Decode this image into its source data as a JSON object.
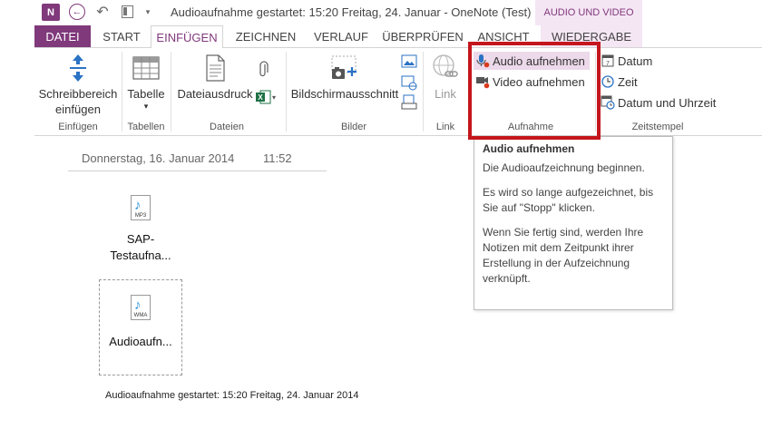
{
  "titlebar": {
    "app_logo": "N",
    "document_title": "Audioaufnahme gestartet: 15:20 Freitag, 24. Januar - OneNote (Test)",
    "contextual_header": "AUDIO UND VIDEO"
  },
  "tabs": [
    {
      "label": "DATEI"
    },
    {
      "label": "START"
    },
    {
      "label": "EINFÜGEN"
    },
    {
      "label": "ZEICHNEN"
    },
    {
      "label": "VERLAUF"
    },
    {
      "label": "ÜBERPRÜFEN"
    },
    {
      "label": "ANSICHT"
    },
    {
      "label": "WIEDERGABE"
    }
  ],
  "ribbon": {
    "einfuegen": {
      "button_line1": "Schreibbereich",
      "button_line2": "einfügen",
      "group": "Einfügen"
    },
    "tabellen": {
      "button": "Tabelle",
      "group": "Tabellen"
    },
    "dateien": {
      "button": "Dateiausdruck",
      "group": "Dateien"
    },
    "bilder": {
      "button": "Bildschirmausschnitt",
      "group": "Bilder"
    },
    "link": {
      "button": "Link",
      "group": "Link"
    },
    "aufnahme": {
      "audio": "Audio aufnehmen",
      "video": "Video aufnehmen",
      "group": "Aufnahme"
    },
    "zeitstempel": {
      "datum": "Datum",
      "zeit": "Zeit",
      "datum_zeit": "Datum und Uhrzeit",
      "group": "Zeitstempel"
    }
  },
  "tooltip": {
    "title": "Audio aufnehmen",
    "line1": "Die Audioaufzeichnung beginnen.",
    "line2": "Es wird so lange aufgezeichnet, bis Sie auf \"Stopp\" klicken.",
    "line3": "Wenn Sie fertig sind, werden Ihre Notizen mit dem Zeitpunkt ihrer Erstellung in der Aufzeichnung verknüpft."
  },
  "page": {
    "date": "Donnerstag, 16. Januar 2014",
    "time": "11:52",
    "files": [
      {
        "ext": "MP3",
        "name_line1": "SAP-",
        "name_line2": "Testaufna..."
      },
      {
        "ext": "WMA",
        "name_line1": "Audioaufn..."
      }
    ],
    "status": "Audioaufnahme gestartet: 15:20 Freitag, 24. Januar 2014"
  },
  "colors": {
    "accent": "#80397b",
    "contextual_bg": "#f5e6f4",
    "highlight_border": "#c4161c"
  }
}
